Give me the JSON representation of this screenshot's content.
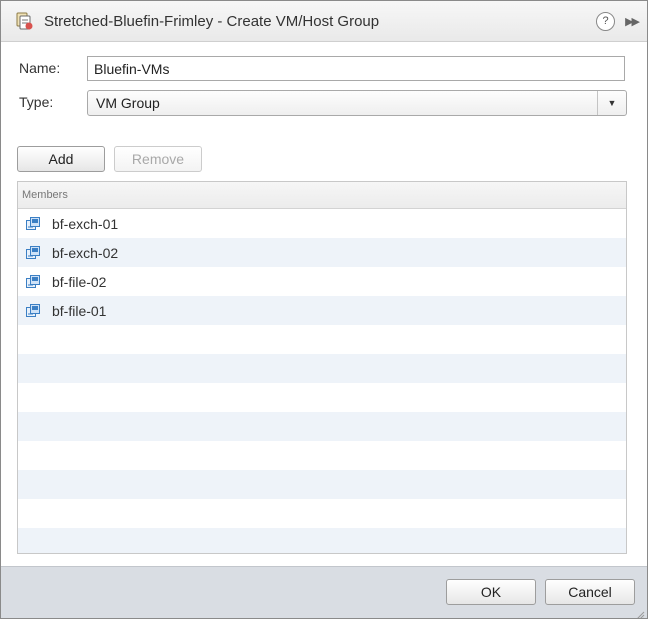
{
  "dialog": {
    "title": "Stretched-Bluefin-Frimley - Create VM/Host Group",
    "help_glyph": "?",
    "expand_glyph": "▶▶",
    "title_icon": "cluster-rule-icon",
    "accent_color": "#3b7fc4"
  },
  "form": {
    "name_label": "Name:",
    "name_value": "Bluefin-VMs",
    "type_label": "Type:",
    "type_value": "VM Group",
    "type_arrow": "▼"
  },
  "toolbar": {
    "add_label": "Add",
    "remove_label": "Remove"
  },
  "members": {
    "header": "Members",
    "row_icon": "virtual-machine-icon",
    "items": [
      {
        "label": "bf-exch-01"
      },
      {
        "label": "bf-exch-02"
      },
      {
        "label": "bf-file-02"
      },
      {
        "label": "bf-file-01"
      }
    ]
  },
  "footer": {
    "ok_label": "OK",
    "cancel_label": "Cancel"
  }
}
